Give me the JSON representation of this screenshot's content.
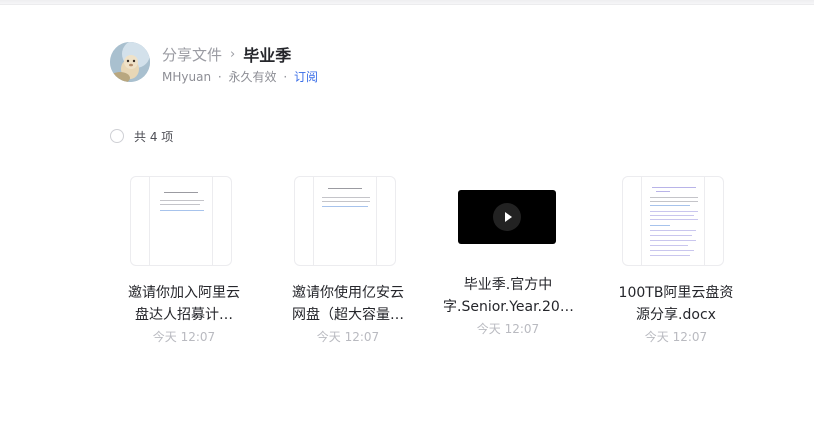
{
  "breadcrumb": {
    "parent": "分享文件",
    "separator": "›",
    "current": "毕业季"
  },
  "meta": {
    "owner": "MHyuan",
    "dot": "·",
    "validity": "永久有效",
    "subscribe": "订阅"
  },
  "count_label": "共 4 项",
  "files": [
    {
      "name_line1": "邀请你加入阿里云",
      "name_line2": "盘达人招募计…",
      "time": "今天 12:07",
      "kind": "doc"
    },
    {
      "name_line1": "邀请你使用亿安云",
      "name_line2": "网盘（超大容量…",
      "time": "今天 12:07",
      "kind": "doc"
    },
    {
      "name_line1": "毕业季.官方中",
      "name_line2": "字.Senior.Year.20…",
      "time": "今天 12:07",
      "kind": "video"
    },
    {
      "name_line1": "100TB阿里云盘资",
      "name_line2": "源分享.docx",
      "time": "今天 12:07",
      "kind": "doc"
    }
  ],
  "colors": {
    "accent": "#3a6ee8",
    "muted": "#9a9ba2",
    "text": "#25262b"
  }
}
